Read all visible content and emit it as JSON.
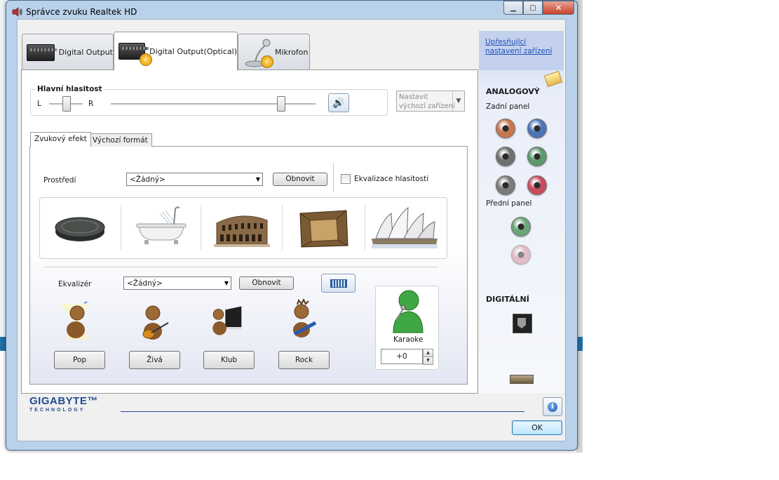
{
  "window": {
    "title": "Správce zvuku Realtek HD",
    "minimize": "▁",
    "maximize": "▢",
    "close": "✕"
  },
  "tabs": [
    {
      "label": "Digital Output",
      "active": false
    },
    {
      "label": "Digital Output(Optical)",
      "active": true
    },
    {
      "label": "Mikrofon",
      "active": false
    }
  ],
  "volume": {
    "title": "Hlavní hlasitost",
    "left_label": "L",
    "right_label": "R",
    "balance": 0.5,
    "level": 0.83
  },
  "default_device": {
    "line1": "Nastavit",
    "line2": "výchozí zařízení"
  },
  "inner_tabs": [
    {
      "label": "Zvukový efekt",
      "active": true
    },
    {
      "label": "Výchozí formát",
      "active": false
    }
  ],
  "environment": {
    "label": "Prostředí",
    "value": "<Žádný>",
    "reset": "Obnovit",
    "loudness_label": "Ekvalizace hlasitosti"
  },
  "equalizer": {
    "label": "Ekvalizér",
    "value": "<Žádný>",
    "reset": "Obnovit",
    "presets": [
      "Pop",
      "Živá",
      "Klub",
      "Rock"
    ]
  },
  "karaoke": {
    "label": "Karaoke",
    "value": "+0"
  },
  "right_panel": {
    "link": "Upřesňující nastavení zařízení",
    "analog_heading": "ANALOGOVÝ",
    "rear_label": "Zadní panel",
    "front_label": "Přední panel",
    "digital_heading": "DIGITÁLNÍ"
  },
  "jack_colors": {
    "orange": "#c8764f",
    "blue": "#4d74b8",
    "gray": "#6f6f6f",
    "green": "#5c9a6c",
    "pink": "#c84a5e",
    "front_green": "#6aa67a",
    "front_pink": "#d8909c"
  },
  "footer": {
    "brand": "GIGABYTE™",
    "brand_sub": "TECHNOLOGY",
    "ok": "OK",
    "info": "i"
  }
}
